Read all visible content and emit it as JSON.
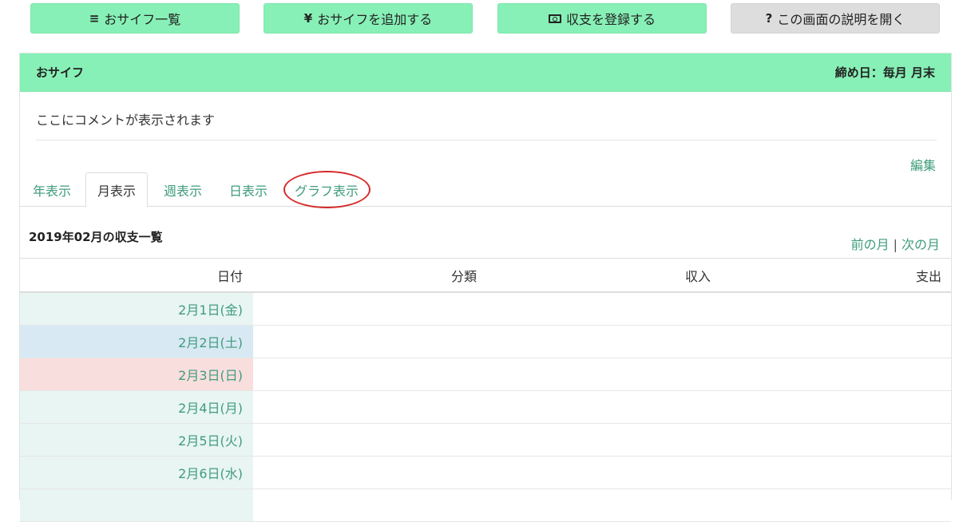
{
  "toolbar": {
    "wallet_list": {
      "label": "おサイフ一覧",
      "icon": "list-icon"
    },
    "add_wallet": {
      "label": "おサイフを追加する",
      "icon": "yen-icon"
    },
    "register": {
      "label": "収支を登録する",
      "icon": "money-icon"
    },
    "help": {
      "label": "この画面の説明を開く",
      "icon": "question-icon"
    }
  },
  "panel": {
    "title": "おサイフ",
    "closing_day": "締め日：毎月 月末",
    "comment": "ここにコメントが表示されます",
    "edit_label": "編集"
  },
  "tabs": [
    {
      "label": "年表示"
    },
    {
      "label": "月表示"
    },
    {
      "label": "週表示"
    },
    {
      "label": "日表示"
    },
    {
      "label": "グラフ表示"
    }
  ],
  "list": {
    "title": "2019年02月の収支一覧",
    "prev_month": "前の月",
    "separator": "|",
    "next_month": "次の月"
  },
  "table": {
    "headers": {
      "date": "日付",
      "category": "分類",
      "income": "収入",
      "expense": "支出"
    },
    "rows": [
      {
        "date": "2月1日(金)"
      },
      {
        "date": "2月2日(土)"
      },
      {
        "date": "2月3日(日)"
      },
      {
        "date": "2月4日(月)"
      },
      {
        "date": "2月5日(火)"
      },
      {
        "date": "2月6日(水)"
      }
    ]
  },
  "colors": {
    "accent_green": "#87f0b6",
    "link_green": "#3f9c7b",
    "weekday_bg": "#e8f5f3",
    "saturday_bg": "#d8e9f4",
    "sunday_bg": "#f9dede",
    "highlight_red": "#d62a2a"
  }
}
